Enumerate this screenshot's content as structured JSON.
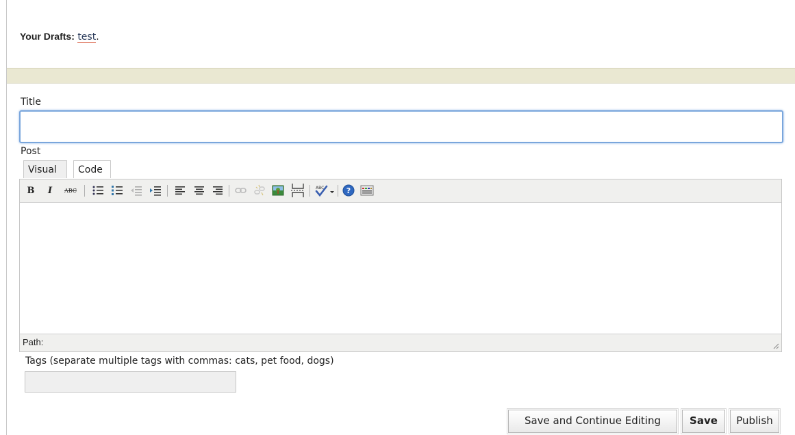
{
  "drafts": {
    "label": "Your Drafts:",
    "link": "test",
    "suffix": "."
  },
  "form": {
    "title_label": "Title",
    "title_value": "",
    "post_label": "Post",
    "tabs": [
      "Visual",
      "Code"
    ],
    "path_label": "Path:",
    "tags_label": "Tags (separate multiple tags with commas: cats, pet food, dogs)",
    "tags_value": ""
  },
  "toolbar": {
    "bold": "B",
    "italic": "I",
    "strikethrough": "ABC"
  },
  "buttons": {
    "save_continue": "Save and Continue Editing",
    "save": "Save",
    "publish": "Publish"
  },
  "colors": {
    "band": "#eae8d2",
    "focus_border": "#7aa6dc",
    "link_underline": "#d03a1a"
  }
}
